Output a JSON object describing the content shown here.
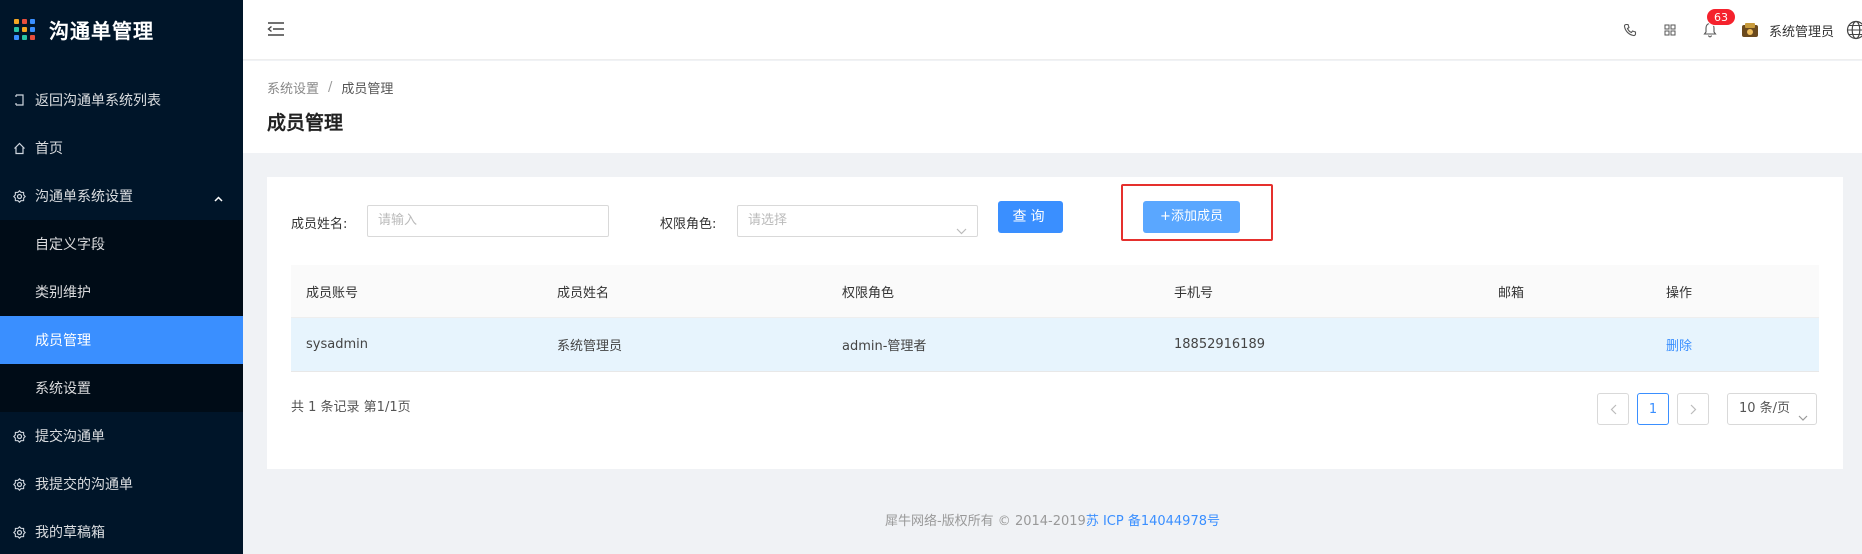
{
  "app": {
    "title": "沟通单管理",
    "logo_colors": [
      "#f5a623",
      "#e94e3c",
      "#3a8fff",
      "#2bc4a5",
      "#f5a623",
      "#3a8fff",
      "#3a8fff",
      "#2bc4a5",
      "#e94e3c"
    ]
  },
  "sidebar": {
    "back": {
      "label": "返回沟通单系统列表",
      "icon": "return-icon"
    },
    "home": {
      "label": "首页",
      "icon": "home-icon"
    },
    "settings_group": {
      "label": "沟通单系统设置",
      "icon": "gear-icon",
      "expanded": true
    },
    "sub_items": [
      {
        "label": "自定义字段"
      },
      {
        "label": "类别维护"
      },
      {
        "label": "成员管理",
        "active": true
      },
      {
        "label": "系统设置"
      }
    ],
    "submit": {
      "label": "提交沟通单",
      "icon": "gear-icon"
    },
    "my_submitted": {
      "label": "我提交的沟通单",
      "icon": "gear-icon"
    },
    "drafts": {
      "label": "我的草稿箱",
      "icon": "gear-icon"
    }
  },
  "header": {
    "notification_count": "63",
    "user_name": "系统管理员",
    "icons": [
      "phone-icon",
      "grid-icon",
      "bell-icon",
      "avatar",
      "globe-icon"
    ]
  },
  "breadcrumb": {
    "parent": "系统设置",
    "separator": "/",
    "current": "成员管理"
  },
  "page_title": "成员管理",
  "filter": {
    "name_label": "成员姓名:",
    "name_placeholder": "请输入",
    "role_label": "权限角色:",
    "role_placeholder": "请选择",
    "query_button": "查询",
    "add_button": "+添加成员"
  },
  "table": {
    "columns": [
      "成员账号",
      "成员姓名",
      "权限角色",
      "手机号",
      "邮箱",
      "操作"
    ],
    "rows": [
      {
        "account": "sysadmin",
        "name": "系统管理员",
        "role": "admin-管理者",
        "phone": "18852916189",
        "email": "",
        "action": "删除"
      }
    ]
  },
  "pagination": {
    "summary": "共 1 条记录 第1/1页",
    "current_page": "1",
    "page_size": "10 条/页"
  },
  "footer": {
    "copyright": "犀牛网络-版权所有 © 2014-2019",
    "icp": "苏 ICP 备14044978号"
  }
}
